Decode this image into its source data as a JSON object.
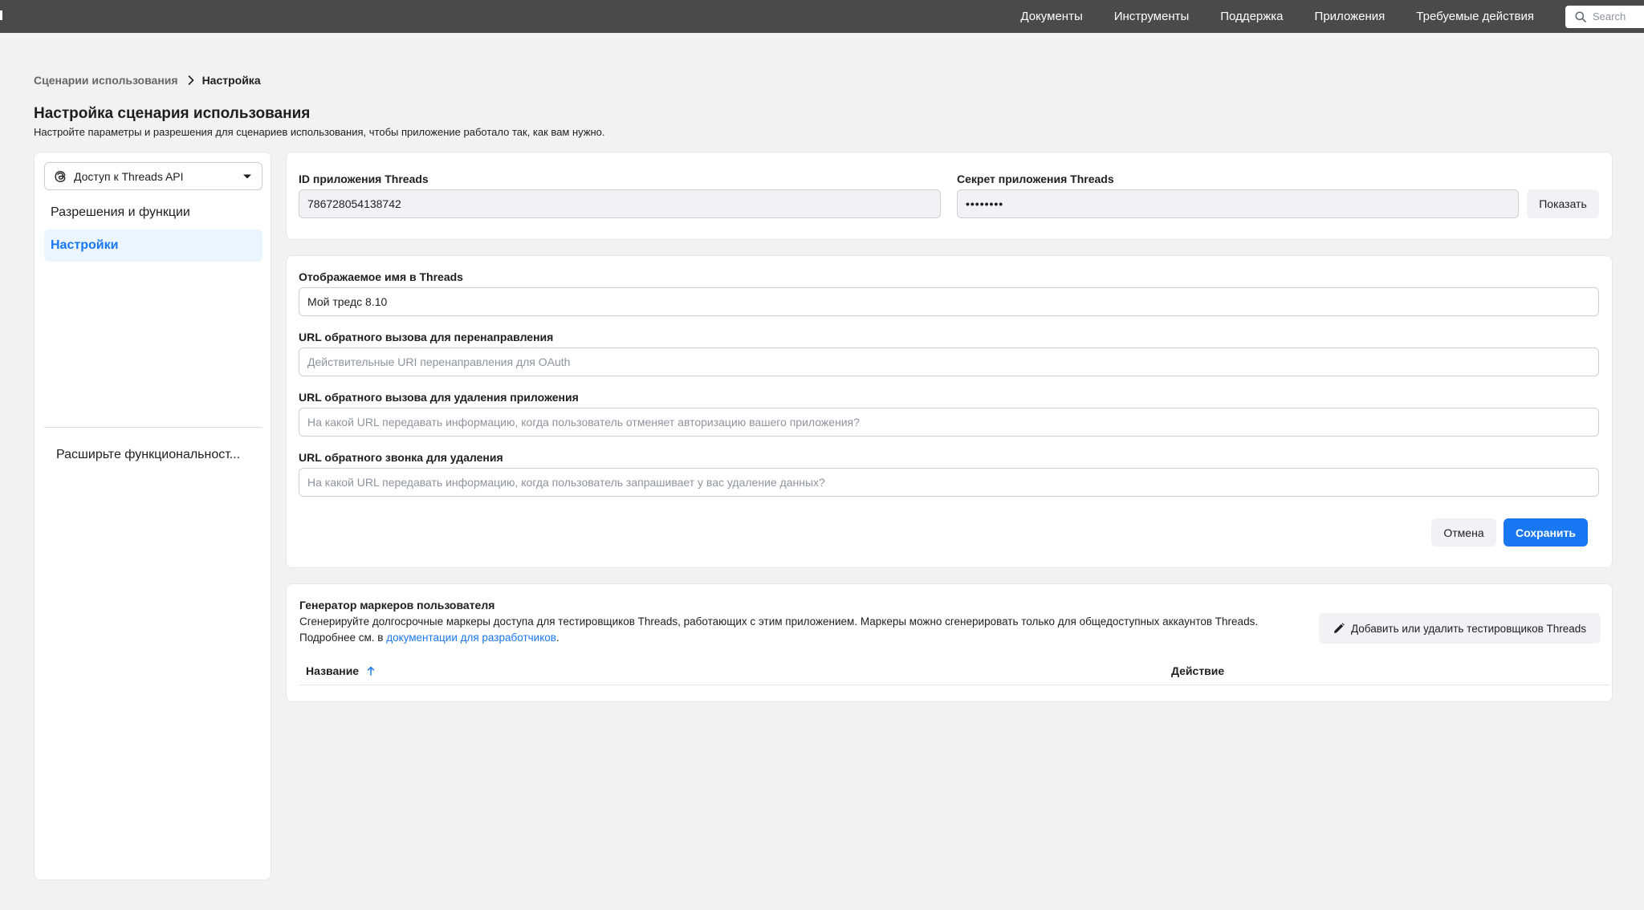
{
  "topbar": {
    "nav": [
      "Документы",
      "Инструменты",
      "Поддержка",
      "Приложения",
      "Требуемые действия"
    ],
    "search_placeholder": "Search"
  },
  "breadcrumb": {
    "parent": "Сценарии использования",
    "current": "Настройка"
  },
  "header": {
    "title": "Настройка сценария использования",
    "subtitle": "Настройте параметры и разрешения для сценариев использования, чтобы приложение работало так, как вам нужно."
  },
  "sidebar": {
    "dropdown_label": "Доступ к Threads API",
    "items": [
      {
        "label": "Разрешения и функции",
        "active": false
      },
      {
        "label": "Настройки",
        "active": true
      }
    ],
    "extend_label": "Расширьте функциональност..."
  },
  "credentials": {
    "app_id_label": "ID приложения Threads",
    "app_id_value": "786728054138742",
    "secret_label": "Секрет приложения Threads",
    "secret_value": "••••••••",
    "show_label": "Показать"
  },
  "settings": {
    "display_name_label": "Отображаемое имя в Threads",
    "display_name_value": "Мой тредс 8.10",
    "redirect_label": "URL обратного вызова для перенаправления",
    "redirect_placeholder": "Действительные URI перенаправления для OAuth",
    "uninstall_label": "URL обратного вызова для удаления приложения",
    "uninstall_placeholder": "На какой URL передавать информацию, когда пользователь отменяет авторизацию вашего приложения?",
    "delete_label": "URL обратного звонка для удаления",
    "delete_placeholder": "На какой URL передавать информацию, когда пользователь запрашивает у вас удаление данных?",
    "cancel_label": "Отмена",
    "save_label": "Сохранить"
  },
  "token_generator": {
    "title": "Генератор маркеров пользователя",
    "desc_line1": "Сгенерируйте долгосрочные маркеры доступа для тестировщиков Threads, работающих с этим приложением. Маркеры можно сгенерировать только для общедоступных аккаунтов Threads.",
    "desc_prefix": "Подробнее см. в ",
    "desc_link": "документации для разработчиков",
    "desc_suffix": ".",
    "add_testers_label": "Добавить или удалить тестировщиков Threads",
    "col_name": "Название",
    "col_action": "Действие"
  },
  "colors": {
    "accent": "#1877f2",
    "topbar": "#4a4a4a",
    "page_bg": "#f2f2f2"
  }
}
